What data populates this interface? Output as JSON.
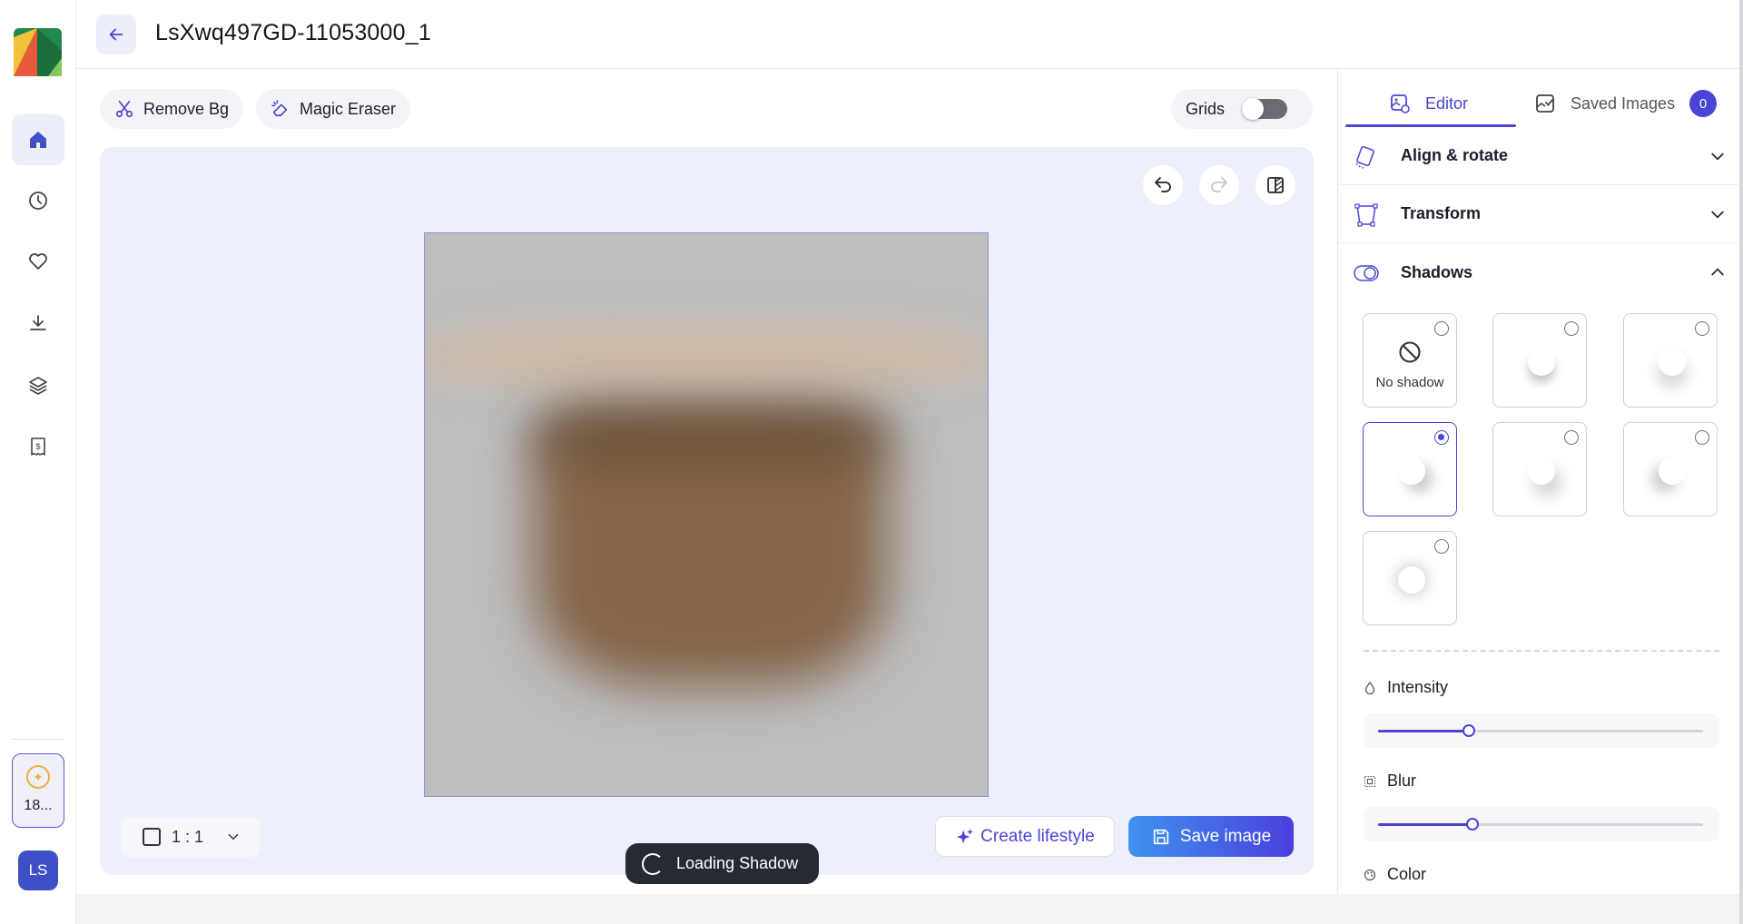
{
  "header": {
    "title": "LsXwq497GD-11053000_1"
  },
  "rail": {
    "items": [
      "home-icon",
      "history-icon",
      "heart-icon",
      "download-icon",
      "layers-icon",
      "receipt-icon"
    ],
    "active_item": "home-icon",
    "credits": "18...",
    "user_initials": "LS"
  },
  "toolbar": {
    "remove_bg": "Remove Bg",
    "magic_eraser": "Magic Eraser",
    "grids": "Grids",
    "grids_on": false
  },
  "canvas": {
    "ratio": "1 : 1",
    "create_lifestyle": "Create lifestyle",
    "save_image": "Save image",
    "loading": "Loading Shadow"
  },
  "panel": {
    "tabs": {
      "editor": "Editor",
      "saved": "Saved Images",
      "saved_count": "0"
    },
    "sections": {
      "align": "Align & rotate",
      "transform": "Transform",
      "shadows": "Shadows"
    },
    "shadow_options": {
      "no_shadow": "No shadow",
      "selected_index": 3
    },
    "intensity": {
      "label": "Intensity",
      "value": 0.28
    },
    "blur": {
      "label": "Blur",
      "value": 0.29
    },
    "color": {
      "label": "Color"
    }
  },
  "colors": {
    "accent": "#4a45d4",
    "canvas_bg": "#edf0fb"
  }
}
